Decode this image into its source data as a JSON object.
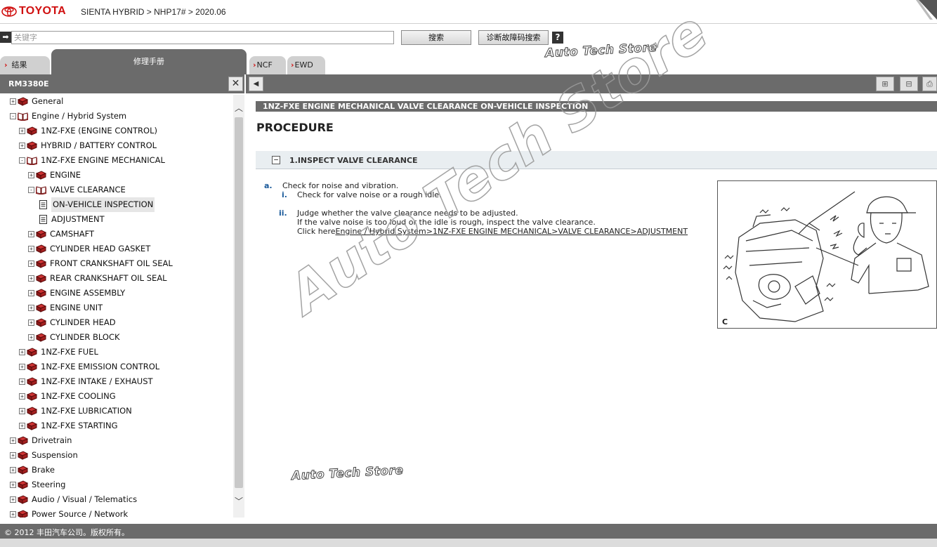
{
  "header": {
    "brand": "TOYOTA",
    "breadcrumb": "SIENTA HYBRID > NHP17# > 2020.06"
  },
  "search": {
    "placeholder": "关键字",
    "search_label": "搜索",
    "dtc_label": "诊断故障码搜索",
    "help_label": "?"
  },
  "tabs": [
    {
      "label": "结果"
    },
    {
      "label": "修理手册"
    },
    {
      "label": "NCF"
    },
    {
      "label": "EWD"
    }
  ],
  "sidebar": {
    "title": "RM3380E",
    "close_label": "✕"
  },
  "tree": [
    {
      "label": "General",
      "level": 0,
      "state": "+",
      "icon": "book"
    },
    {
      "label": "Engine / Hybrid System",
      "level": 0,
      "state": "-",
      "icon": "book-open"
    },
    {
      "label": "1NZ-FXE (ENGINE CONTROL)",
      "level": 1,
      "state": "+",
      "icon": "book"
    },
    {
      "label": "HYBRID / BATTERY CONTROL",
      "level": 1,
      "state": "+",
      "icon": "book"
    },
    {
      "label": "1NZ-FXE ENGINE MECHANICAL",
      "level": 1,
      "state": "-",
      "icon": "book-open"
    },
    {
      "label": "ENGINE",
      "level": 2,
      "state": "+",
      "icon": "book"
    },
    {
      "label": "VALVE CLEARANCE",
      "level": 2,
      "state": "-",
      "icon": "book-open"
    },
    {
      "label": "ON-VEHICLE INSPECTION",
      "level": 3,
      "state": "",
      "icon": "doc",
      "selected": true
    },
    {
      "label": "ADJUSTMENT",
      "level": 3,
      "state": "",
      "icon": "doc"
    },
    {
      "label": "CAMSHAFT",
      "level": 2,
      "state": "+",
      "icon": "book"
    },
    {
      "label": "CYLINDER HEAD GASKET",
      "level": 2,
      "state": "+",
      "icon": "book"
    },
    {
      "label": "FRONT CRANKSHAFT OIL SEAL",
      "level": 2,
      "state": "+",
      "icon": "book"
    },
    {
      "label": "REAR CRANKSHAFT OIL SEAL",
      "level": 2,
      "state": "+",
      "icon": "book"
    },
    {
      "label": "ENGINE ASSEMBLY",
      "level": 2,
      "state": "+",
      "icon": "book"
    },
    {
      "label": "ENGINE UNIT",
      "level": 2,
      "state": "+",
      "icon": "book"
    },
    {
      "label": "CYLINDER HEAD",
      "level": 2,
      "state": "+",
      "icon": "book"
    },
    {
      "label": "CYLINDER BLOCK",
      "level": 2,
      "state": "+",
      "icon": "book"
    },
    {
      "label": "1NZ-FXE FUEL",
      "level": 1,
      "state": "+",
      "icon": "book"
    },
    {
      "label": "1NZ-FXE EMISSION CONTROL",
      "level": 1,
      "state": "+",
      "icon": "book"
    },
    {
      "label": "1NZ-FXE INTAKE / EXHAUST",
      "level": 1,
      "state": "+",
      "icon": "book"
    },
    {
      "label": "1NZ-FXE COOLING",
      "level": 1,
      "state": "+",
      "icon": "book"
    },
    {
      "label": "1NZ-FXE LUBRICATION",
      "level": 1,
      "state": "+",
      "icon": "book"
    },
    {
      "label": "1NZ-FXE STARTING",
      "level": 1,
      "state": "+",
      "icon": "book"
    },
    {
      "label": "Drivetrain",
      "level": 0,
      "state": "+",
      "icon": "book"
    },
    {
      "label": "Suspension",
      "level": 0,
      "state": "+",
      "icon": "book"
    },
    {
      "label": "Brake",
      "level": 0,
      "state": "+",
      "icon": "book"
    },
    {
      "label": "Steering",
      "level": 0,
      "state": "+",
      "icon": "book"
    },
    {
      "label": "Audio / Visual / Telematics",
      "level": 0,
      "state": "+",
      "icon": "book"
    },
    {
      "label": "Power Source / Network",
      "level": 0,
      "state": "+",
      "icon": "book"
    }
  ],
  "content": {
    "title": "1NZ-FXE ENGINE MECHANICAL  VALVE CLEARANCE  ON-VEHICLE INSPECTION",
    "heading": "PROCEDURE",
    "step_title": "1.INSPECT VALVE CLEARANCE",
    "item_a_marker": "a.",
    "item_a_text": "Check for noise and vibration.",
    "sub_i_marker": "i.",
    "sub_i_text": "Check for valve noise or a rough idle.",
    "sub_ii_marker": "ii.",
    "sub_ii_line1": "Judge whether the valve clearance needs to be adjusted.",
    "sub_ii_line2": "If the valve noise is too loud or the idle is rough, inspect the valve clearance.",
    "click_prefix": "Click here",
    "click_link": "Engine / Hybrid System>1NZ-FXE ENGINE MECHANICAL>VALVE CLEARANCE>ADJUSTMENT",
    "figure_code": "C"
  },
  "watermark": {
    "text": "Auto Tech Store"
  },
  "footer": {
    "copyright": "© 2012 丰田汽车公司。版权所有。"
  },
  "icons": {
    "toolbar": [
      "expand-all-icon",
      "collapse-all-icon",
      "print-icon"
    ]
  }
}
